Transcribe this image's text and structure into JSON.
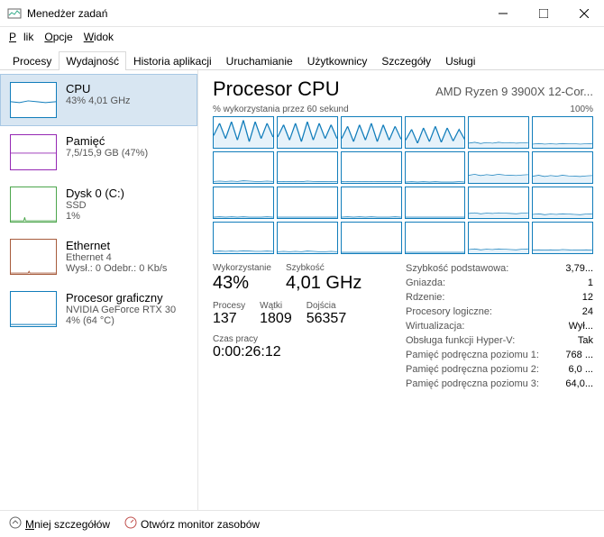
{
  "window": {
    "title": "Menedżer zadań"
  },
  "menu": {
    "file": "Plik",
    "options": "Opcje",
    "view": "Widok"
  },
  "tabs": {
    "processes": "Procesy",
    "performance": "Wydajność",
    "apphistory": "Historia aplikacji",
    "startup": "Uruchamianie",
    "users": "Użytkownicy",
    "details": "Szczegóły",
    "services": "Usługi"
  },
  "sidebar": [
    {
      "title": "CPU",
      "sub": "43%  4,01 GHz"
    },
    {
      "title": "Pamięć",
      "sub": "7,5/15,9 GB (47%)"
    },
    {
      "title": "Dysk 0 (C:)",
      "sub1": "SSD",
      "sub2": "1%"
    },
    {
      "title": "Ethernet",
      "sub1": "Ethernet 4",
      "sub2": "Wysł.: 0  Odebr.: 0 Kb/s"
    },
    {
      "title": "Procesor graficzny",
      "sub1": "NVIDIA GeForce RTX 30",
      "sub2": "4%  (64 °C)"
    }
  ],
  "detail": {
    "heading": "Procesor CPU",
    "model": "AMD Ryzen 9 3900X 12-Cor...",
    "graph_label_left": "% wykorzystania przez 60 sekund",
    "graph_label_right": "100%",
    "stats": {
      "util_label": "Wykorzystanie",
      "util_value": "43%",
      "speed_label": "Szybkość",
      "speed_value": "4,01 GHz",
      "proc_label": "Procesy",
      "proc_value": "137",
      "thread_label": "Wątki",
      "thread_value": "1809",
      "handle_label": "Dojścia",
      "handle_value": "56357",
      "uptime_label": "Czas pracy",
      "uptime_value": "0:00:26:12"
    },
    "kv": [
      {
        "k": "Szybkość podstawowa:",
        "v": "3,79..."
      },
      {
        "k": "Gniazda:",
        "v": "1"
      },
      {
        "k": "Rdzenie:",
        "v": "12"
      },
      {
        "k": "Procesory logiczne:",
        "v": "24"
      },
      {
        "k": "Wirtualizacja:",
        "v": "Wył..."
      },
      {
        "k": "Obsługa funkcji Hyper-V:",
        "v": "Tak"
      },
      {
        "k": "Pamięć podręczna poziomu 1:",
        "v": "768 ..."
      },
      {
        "k": "Pamięć podręczna poziomu 2:",
        "v": "6,0 ..."
      },
      {
        "k": "Pamięć podręczna poziomu 3:",
        "v": "64,0..."
      }
    ]
  },
  "footer": {
    "fewer": "Mniej szczegółów",
    "resmon": "Otwórz monitor zasobów"
  },
  "chart_data": {
    "type": "line",
    "description": "24 logical-processor mini-graphs, each showing ~60s of CPU utilization 0-100%.",
    "cores": [
      [
        40,
        80,
        30,
        85,
        25,
        90,
        20,
        85,
        30,
        80,
        35
      ],
      [
        35,
        75,
        25,
        80,
        20,
        85,
        25,
        80,
        30,
        75,
        30
      ],
      [
        30,
        70,
        20,
        75,
        25,
        80,
        20,
        75,
        25,
        70,
        28
      ],
      [
        25,
        60,
        15,
        65,
        20,
        70,
        18,
        65,
        22,
        60,
        25
      ],
      [
        15,
        18,
        14,
        17,
        15,
        18,
        16,
        17,
        15,
        16,
        17
      ],
      [
        12,
        14,
        12,
        13,
        12,
        14,
        13,
        13,
        12,
        13,
        14
      ],
      [
        5,
        6,
        5,
        6,
        5,
        7,
        6,
        5,
        5,
        6,
        5
      ],
      [
        4,
        5,
        4,
        5,
        4,
        6,
        5,
        4,
        4,
        5,
        4
      ],
      [
        4,
        5,
        4,
        5,
        4,
        5,
        4,
        4,
        4,
        5,
        4
      ],
      [
        3,
        4,
        3,
        4,
        3,
        4,
        3,
        3,
        3,
        4,
        3
      ],
      [
        25,
        28,
        24,
        27,
        25,
        28,
        26,
        25,
        24,
        26,
        27
      ],
      [
        22,
        25,
        21,
        24,
        22,
        25,
        23,
        22,
        21,
        23,
        24
      ],
      [
        3,
        4,
        3,
        4,
        3,
        4,
        3,
        3,
        3,
        4,
        3
      ],
      [
        3,
        3,
        3,
        3,
        3,
        3,
        3,
        3,
        3,
        3,
        3
      ],
      [
        3,
        4,
        3,
        4,
        3,
        4,
        3,
        3,
        3,
        4,
        3
      ],
      [
        3,
        3,
        3,
        3,
        3,
        3,
        3,
        3,
        3,
        3,
        3
      ],
      [
        15,
        17,
        14,
        16,
        15,
        17,
        16,
        15,
        14,
        16,
        17
      ],
      [
        12,
        14,
        11,
        13,
        12,
        14,
        13,
        12,
        11,
        13,
        14
      ],
      [
        6,
        7,
        6,
        7,
        6,
        8,
        7,
        6,
        6,
        7,
        6
      ],
      [
        5,
        6,
        5,
        6,
        5,
        7,
        6,
        5,
        5,
        6,
        5
      ],
      [
        3,
        3,
        3,
        3,
        3,
        3,
        3,
        3,
        3,
        3,
        3
      ],
      [
        3,
        3,
        3,
        3,
        3,
        3,
        3,
        3,
        3,
        3,
        3
      ],
      [
        12,
        14,
        11,
        13,
        12,
        14,
        13,
        12,
        11,
        13,
        14
      ],
      [
        10,
        11,
        10,
        11,
        10,
        12,
        11,
        10,
        10,
        11,
        10
      ]
    ],
    "ylim": [
      0,
      100
    ]
  }
}
